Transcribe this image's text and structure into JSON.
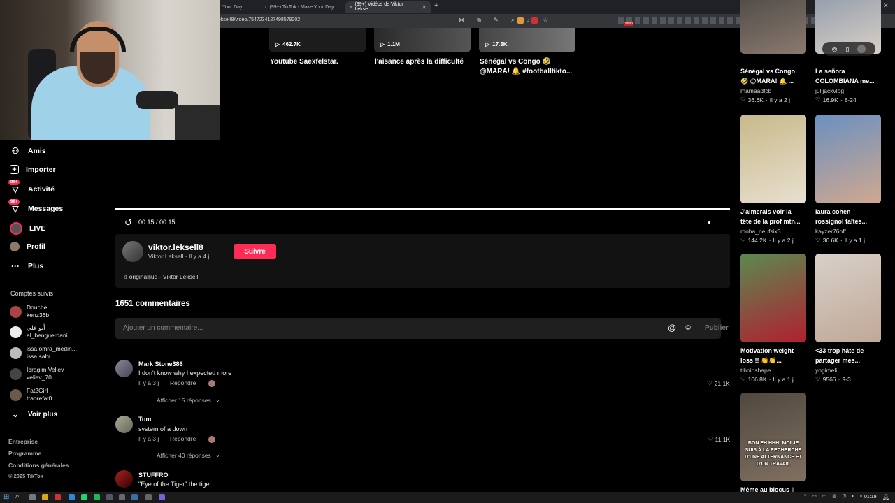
{
  "browser": {
    "tabs": [
      {
        "label": "Your Day"
      },
      {
        "label": "(99+) TikTok - Make Your Day"
      },
      {
        "label": "(99+) Vidéos de Viktor Lekse..."
      }
    ],
    "url": "ekseII8/video/7547234127498579202",
    "extension_badge": "9893"
  },
  "sidebar": {
    "items": [
      {
        "label": "Amis"
      },
      {
        "label": "Importer"
      },
      {
        "label": "Activité",
        "badge": "99+"
      },
      {
        "label": "Messages",
        "badge": "99+"
      },
      {
        "label": "LIVE"
      },
      {
        "label": "Profil"
      },
      {
        "label": "Plus"
      }
    ],
    "following_title": "Comptes suivis",
    "following": [
      {
        "name": "Douche",
        "handle": "kenz36b"
      },
      {
        "name": "أبو علي",
        "handle": "al_benguerdani"
      },
      {
        "name": "issa.omra_medin...",
        "handle": "issa.sabr"
      },
      {
        "name": "Ibragim Veliev",
        "handle": "veliev_70"
      },
      {
        "name": "Fat2Girl",
        "handle": "traorefat0"
      }
    ],
    "see_more": "Voir plus",
    "footer": [
      "Entreprise",
      "Programme",
      "Conditions générales",
      "© 2025 TikTok"
    ]
  },
  "top_videos": [
    {
      "count": "462.7K",
      "caption1": "Youtube Saexfelstar.",
      "caption2": ""
    },
    {
      "count": "1.1M",
      "caption1": "l'aisance après la difficulté",
      "caption2": ""
    },
    {
      "count": "17.3K",
      "caption1": "Sénégal vs Congo 🤣",
      "caption2": "@MARA! 🔔 #footballtikto..."
    }
  ],
  "player": {
    "time": "00:15 / 00:15",
    "progress": 1.0
  },
  "author": {
    "username": "viktor.leksell8",
    "subline": "Viktor Leksell · Il y a 4 j",
    "follow_label": "Suivre",
    "music": "♫ originalljud - Viktor Leksell"
  },
  "comments": {
    "count_label": "1651 commentaires",
    "input_placeholder": "Ajouter un commentaire...",
    "post_label": "Publier",
    "items": [
      {
        "name": "Mark Stone386",
        "text": "I don't know why I expected more",
        "time": "Il y a 3 j",
        "reply": "Répondre",
        "likes": "21.1K",
        "replies": "Afficher 15 réponses"
      },
      {
        "name": "Tom",
        "text": "system of a down",
        "time": "Il y a 3 j",
        "reply": "Répondre",
        "likes": "11.1K",
        "replies": "Afficher 40 réponses"
      },
      {
        "name": "STUFFRO",
        "text": "\"Eye of the Tiger\" the tiger :"
      }
    ]
  },
  "recommended": [
    {
      "title1": "Sénégal vs Congo",
      "title2": "🤣 @MARA! 🔔 ...",
      "user": "mamaadfcb",
      "likes": "36.6K",
      "date": "Il y a 2 j",
      "colors": [
        "#3a3a3a",
        "#8a7a6e"
      ]
    },
    {
      "title1": "La señora",
      "title2": "COLOMBIANA me...",
      "user": "julijackvlog",
      "likes": "16.9K",
      "date": "8-24",
      "colors": [
        "#7a8aa0",
        "#d8d0c8"
      ]
    },
    {
      "title1": "J'aimerais voir la",
      "title2": "tête de la prof mtn...",
      "user": "moha_neufsix3",
      "likes": "144.2K",
      "date": "Il y a 2 j",
      "colors": [
        "#c8b98a",
        "#e8e0d0"
      ]
    },
    {
      "title1": "laura cohen",
      "title2": "rossignol faîtes...",
      "user": "kayzer76off",
      "likes": "36.6K",
      "date": "Il y a 1 j",
      "colors": [
        "#6a90c0",
        "#d0a890"
      ]
    },
    {
      "title1": "Motivation weight",
      "title2": "loss !! 👏👏...",
      "user": "tiboinshape",
      "likes": "106.8K",
      "date": "Il y a 1 j",
      "colors": [
        "#5a8a50",
        "#b02030"
      ]
    },
    {
      "title1": "<33 trop hâte de",
      "title2": "partager mes...",
      "user": "yogimeli",
      "likes": "9566",
      "date": "9-3",
      "colors": [
        "#d8d0c8",
        "#c0a898"
      ]
    },
    {
      "title1": "Même au blocus il",
      "title2": "",
      "user": "",
      "likes": "",
      "date": "",
      "overlay": "BON EH HHH! MOI JE SUIS À LA RECHERCHE D'UNE ALTERNANCE ET D'UN TRAVAIL",
      "colors": [
        "#50483f",
        "#807060"
      ]
    }
  ],
  "taskbar": {
    "time": "01:19"
  }
}
